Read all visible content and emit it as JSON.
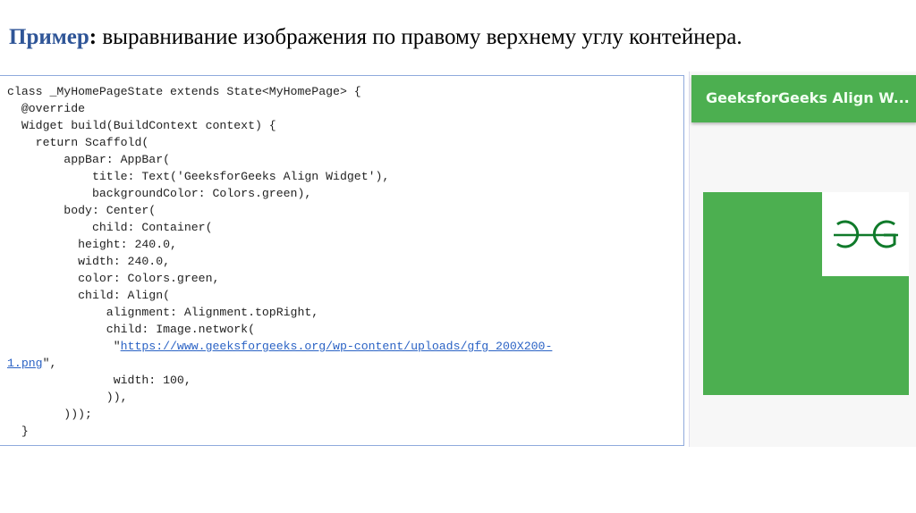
{
  "slide_title": {
    "keyword": "Пример",
    "colon": ":",
    "text": " выравнивание изображения по правому верхнему углу контейнера."
  },
  "code": {
    "before_url": "class _MyHomePageState extends State<MyHomePage> {\n  @override\n  Widget build(BuildContext context) {\n    return Scaffold(\n        appBar: AppBar(\n            title: Text('GeeksforGeeks Align Widget'),\n            backgroundColor: Colors.green),\n        body: Center(\n            child: Container(\n          height: 240.0,\n          width: 240.0,\n          color: Colors.green,\n          child: Align(\n              alignment: Alignment.topRight,\n              child: Image.network(\n               \"",
    "url": "https://www.geeksforgeeks.org/wp-content/uploads/gfg_200X200-\n1.png",
    "after_url": "\",\n               width: 100,\n              )),\n        )));\n  }"
  },
  "preview": {
    "appbar_title": "GeeksforGeeks Align W...",
    "logo_text": "GG",
    "colors": {
      "appbar": "#4caf50",
      "container": "#4caf50",
      "logo": "#0f7a2a"
    }
  }
}
